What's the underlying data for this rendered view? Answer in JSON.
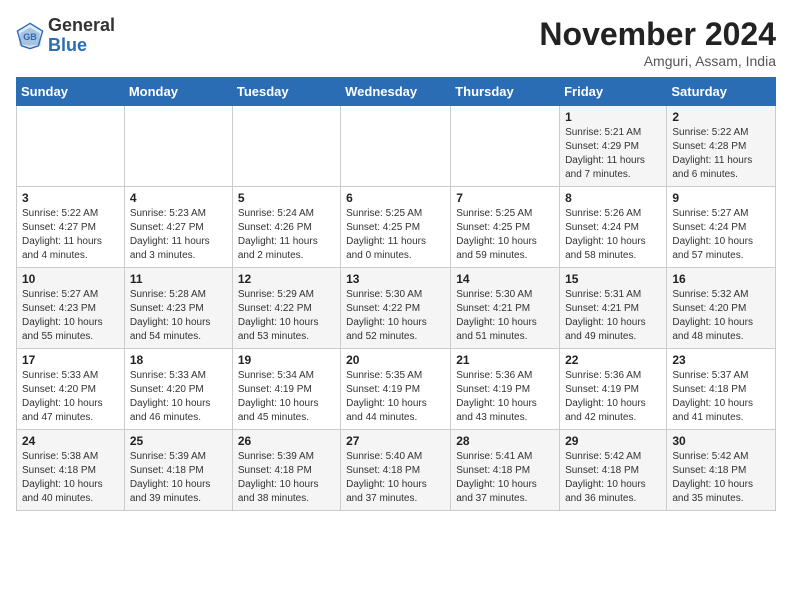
{
  "header": {
    "logo_general": "General",
    "logo_blue": "Blue",
    "month_title": "November 2024",
    "location": "Amguri, Assam, India"
  },
  "days_of_week": [
    "Sunday",
    "Monday",
    "Tuesday",
    "Wednesday",
    "Thursday",
    "Friday",
    "Saturday"
  ],
  "weeks": [
    [
      {
        "day": "",
        "info": ""
      },
      {
        "day": "",
        "info": ""
      },
      {
        "day": "",
        "info": ""
      },
      {
        "day": "",
        "info": ""
      },
      {
        "day": "",
        "info": ""
      },
      {
        "day": "1",
        "info": "Sunrise: 5:21 AM\nSunset: 4:29 PM\nDaylight: 11 hours and 7 minutes."
      },
      {
        "day": "2",
        "info": "Sunrise: 5:22 AM\nSunset: 4:28 PM\nDaylight: 11 hours and 6 minutes."
      }
    ],
    [
      {
        "day": "3",
        "info": "Sunrise: 5:22 AM\nSunset: 4:27 PM\nDaylight: 11 hours and 4 minutes."
      },
      {
        "day": "4",
        "info": "Sunrise: 5:23 AM\nSunset: 4:27 PM\nDaylight: 11 hours and 3 minutes."
      },
      {
        "day": "5",
        "info": "Sunrise: 5:24 AM\nSunset: 4:26 PM\nDaylight: 11 hours and 2 minutes."
      },
      {
        "day": "6",
        "info": "Sunrise: 5:25 AM\nSunset: 4:25 PM\nDaylight: 11 hours and 0 minutes."
      },
      {
        "day": "7",
        "info": "Sunrise: 5:25 AM\nSunset: 4:25 PM\nDaylight: 10 hours and 59 minutes."
      },
      {
        "day": "8",
        "info": "Sunrise: 5:26 AM\nSunset: 4:24 PM\nDaylight: 10 hours and 58 minutes."
      },
      {
        "day": "9",
        "info": "Sunrise: 5:27 AM\nSunset: 4:24 PM\nDaylight: 10 hours and 57 minutes."
      }
    ],
    [
      {
        "day": "10",
        "info": "Sunrise: 5:27 AM\nSunset: 4:23 PM\nDaylight: 10 hours and 55 minutes."
      },
      {
        "day": "11",
        "info": "Sunrise: 5:28 AM\nSunset: 4:23 PM\nDaylight: 10 hours and 54 minutes."
      },
      {
        "day": "12",
        "info": "Sunrise: 5:29 AM\nSunset: 4:22 PM\nDaylight: 10 hours and 53 minutes."
      },
      {
        "day": "13",
        "info": "Sunrise: 5:30 AM\nSunset: 4:22 PM\nDaylight: 10 hours and 52 minutes."
      },
      {
        "day": "14",
        "info": "Sunrise: 5:30 AM\nSunset: 4:21 PM\nDaylight: 10 hours and 51 minutes."
      },
      {
        "day": "15",
        "info": "Sunrise: 5:31 AM\nSunset: 4:21 PM\nDaylight: 10 hours and 49 minutes."
      },
      {
        "day": "16",
        "info": "Sunrise: 5:32 AM\nSunset: 4:20 PM\nDaylight: 10 hours and 48 minutes."
      }
    ],
    [
      {
        "day": "17",
        "info": "Sunrise: 5:33 AM\nSunset: 4:20 PM\nDaylight: 10 hours and 47 minutes."
      },
      {
        "day": "18",
        "info": "Sunrise: 5:33 AM\nSunset: 4:20 PM\nDaylight: 10 hours and 46 minutes."
      },
      {
        "day": "19",
        "info": "Sunrise: 5:34 AM\nSunset: 4:19 PM\nDaylight: 10 hours and 45 minutes."
      },
      {
        "day": "20",
        "info": "Sunrise: 5:35 AM\nSunset: 4:19 PM\nDaylight: 10 hours and 44 minutes."
      },
      {
        "day": "21",
        "info": "Sunrise: 5:36 AM\nSunset: 4:19 PM\nDaylight: 10 hours and 43 minutes."
      },
      {
        "day": "22",
        "info": "Sunrise: 5:36 AM\nSunset: 4:19 PM\nDaylight: 10 hours and 42 minutes."
      },
      {
        "day": "23",
        "info": "Sunrise: 5:37 AM\nSunset: 4:18 PM\nDaylight: 10 hours and 41 minutes."
      }
    ],
    [
      {
        "day": "24",
        "info": "Sunrise: 5:38 AM\nSunset: 4:18 PM\nDaylight: 10 hours and 40 minutes."
      },
      {
        "day": "25",
        "info": "Sunrise: 5:39 AM\nSunset: 4:18 PM\nDaylight: 10 hours and 39 minutes."
      },
      {
        "day": "26",
        "info": "Sunrise: 5:39 AM\nSunset: 4:18 PM\nDaylight: 10 hours and 38 minutes."
      },
      {
        "day": "27",
        "info": "Sunrise: 5:40 AM\nSunset: 4:18 PM\nDaylight: 10 hours and 37 minutes."
      },
      {
        "day": "28",
        "info": "Sunrise: 5:41 AM\nSunset: 4:18 PM\nDaylight: 10 hours and 37 minutes."
      },
      {
        "day": "29",
        "info": "Sunrise: 5:42 AM\nSunset: 4:18 PM\nDaylight: 10 hours and 36 minutes."
      },
      {
        "day": "30",
        "info": "Sunrise: 5:42 AM\nSunset: 4:18 PM\nDaylight: 10 hours and 35 minutes."
      }
    ]
  ]
}
